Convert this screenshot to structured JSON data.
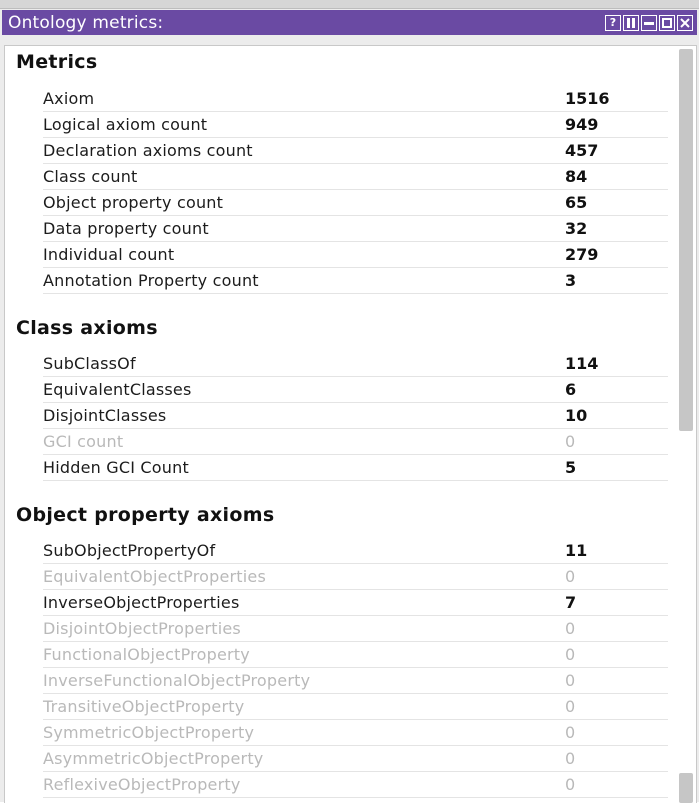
{
  "window": {
    "title": "Ontology metrics:",
    "buttons": [
      "help",
      "split",
      "minimize",
      "maximize",
      "close"
    ]
  },
  "sections": [
    {
      "title": "Metrics",
      "rows": [
        {
          "label": "Axiom",
          "value": "1516"
        },
        {
          "label": "Logical axiom count",
          "value": "949"
        },
        {
          "label": "Declaration axioms count",
          "value": "457"
        },
        {
          "label": "Class count",
          "value": "84"
        },
        {
          "label": "Object property count",
          "value": "65"
        },
        {
          "label": "Data property count",
          "value": "32"
        },
        {
          "label": "Individual count",
          "value": "279"
        },
        {
          "label": "Annotation Property count",
          "value": "3"
        }
      ]
    },
    {
      "title": "Class axioms",
      "rows": [
        {
          "label": "SubClassOf",
          "value": "114"
        },
        {
          "label": "EquivalentClasses",
          "value": "6"
        },
        {
          "label": "DisjointClasses",
          "value": "10"
        },
        {
          "label": "GCI count",
          "value": "0"
        },
        {
          "label": "Hidden GCI Count",
          "value": "5"
        }
      ]
    },
    {
      "title": "Object property axioms",
      "rows": [
        {
          "label": "SubObjectPropertyOf",
          "value": "11"
        },
        {
          "label": "EquivalentObjectProperties",
          "value": "0"
        },
        {
          "label": "InverseObjectProperties",
          "value": "7"
        },
        {
          "label": "DisjointObjectProperties",
          "value": "0"
        },
        {
          "label": "FunctionalObjectProperty",
          "value": "0"
        },
        {
          "label": "InverseFunctionalObjectProperty",
          "value": "0"
        },
        {
          "label": "TransitiveObjectProperty",
          "value": "0"
        },
        {
          "label": "SymmetricObjectProperty",
          "value": "0"
        },
        {
          "label": "AsymmetricObjectProperty",
          "value": "0"
        },
        {
          "label": "ReflexiveObjectProperty",
          "value": "0"
        }
      ]
    }
  ],
  "colors": {
    "titlebar": "#6a4aa3",
    "zero_value": "#b9b9b9"
  }
}
